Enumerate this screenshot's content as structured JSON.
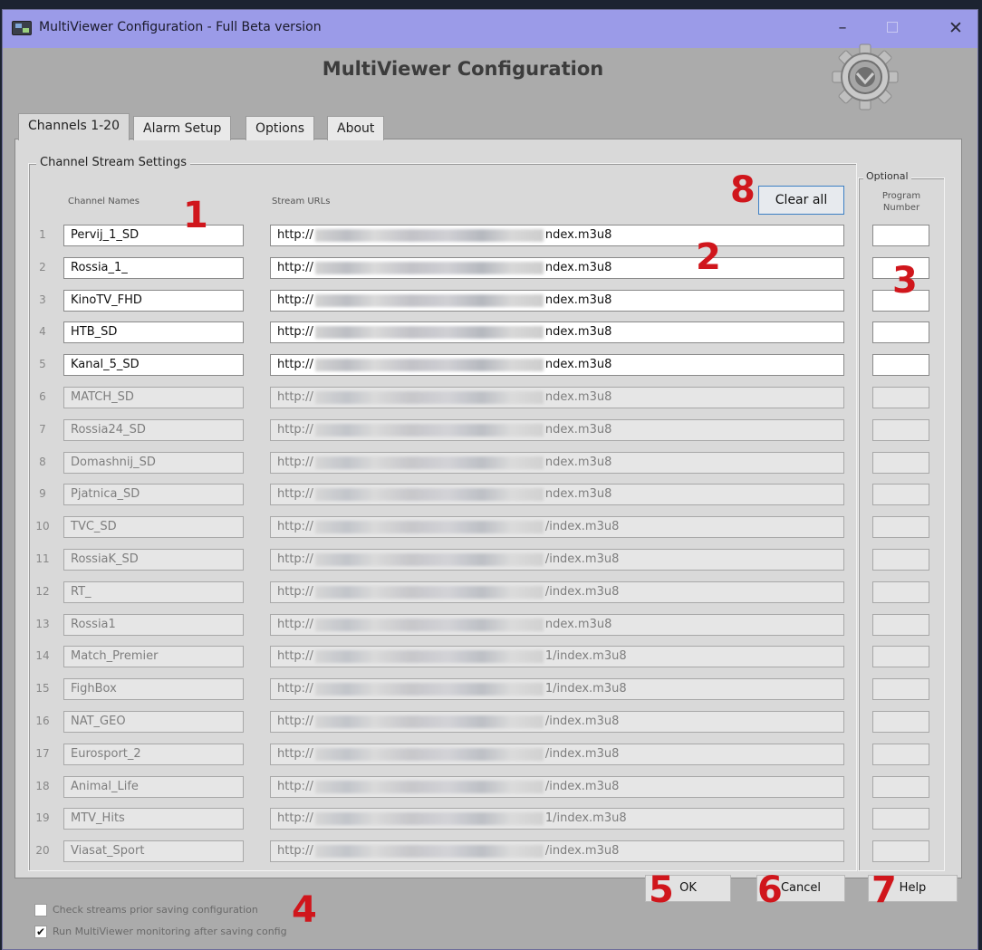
{
  "window": {
    "title": "MultiViewer Configuration - Full Beta version",
    "minimize": "–",
    "close": "✕"
  },
  "header": {
    "title": "MultiViewer Configuration",
    "logo_icon": "gear-icon"
  },
  "tabs": [
    {
      "label": "Channels 1-20",
      "active": true
    },
    {
      "label": "Alarm Setup",
      "active": false
    },
    {
      "label": "Options",
      "active": false
    },
    {
      "label": "About",
      "active": false
    }
  ],
  "panel": {
    "group_label": "Channel Stream Settings",
    "col_names": "Channel Names",
    "col_urls": "Stream URLs",
    "optional_label": "Optional",
    "program_header_1": "Program",
    "program_header_2": "Number",
    "clear_all": "Clear all"
  },
  "channels": [
    {
      "num": "1",
      "name": "Pervij_1_SD",
      "url_prefix": "http://",
      "url_suffix": "ndex.m3u8",
      "enabled": true
    },
    {
      "num": "2",
      "name": "Rossia_1_",
      "url_prefix": "http://",
      "url_suffix": "ndex.m3u8",
      "enabled": true
    },
    {
      "num": "3",
      "name": "KinoTV_FHD",
      "url_prefix": "http://",
      "url_suffix": "ndex.m3u8",
      "enabled": true
    },
    {
      "num": "4",
      "name": "HTB_SD",
      "url_prefix": "http://",
      "url_suffix": "ndex.m3u8",
      "enabled": true
    },
    {
      "num": "5",
      "name": "Kanal_5_SD",
      "url_prefix": "http://",
      "url_suffix": "ndex.m3u8",
      "enabled": true
    },
    {
      "num": "6",
      "name": "MATCH_SD",
      "url_prefix": "http://",
      "url_suffix": "ndex.m3u8",
      "enabled": false
    },
    {
      "num": "7",
      "name": "Rossia24_SD",
      "url_prefix": "http://",
      "url_suffix": "ndex.m3u8",
      "enabled": false
    },
    {
      "num": "8",
      "name": "Domashnij_SD",
      "url_prefix": "http://",
      "url_suffix": "ndex.m3u8",
      "enabled": false
    },
    {
      "num": "9",
      "name": "Pjatnica_SD",
      "url_prefix": "http://",
      "url_suffix": "ndex.m3u8",
      "enabled": false
    },
    {
      "num": "10",
      "name": "TVC_SD",
      "url_prefix": "http://",
      "url_suffix": "/index.m3u8",
      "enabled": false
    },
    {
      "num": "11",
      "name": "RossiaK_SD",
      "url_prefix": "http://",
      "url_suffix": "/index.m3u8",
      "enabled": false
    },
    {
      "num": "12",
      "name": "RT_",
      "url_prefix": "http://",
      "url_suffix": "/index.m3u8",
      "enabled": false
    },
    {
      "num": "13",
      "name": "Rossia1",
      "url_prefix": "http://",
      "url_suffix": "ndex.m3u8",
      "enabled": false
    },
    {
      "num": "14",
      "name": "Match_Premier",
      "url_prefix": "http://",
      "url_suffix": "1/index.m3u8",
      "enabled": false
    },
    {
      "num": "15",
      "name": "FighBox",
      "url_prefix": "http://",
      "url_suffix": "1/index.m3u8",
      "enabled": false
    },
    {
      "num": "16",
      "name": "NAT_GEO",
      "url_prefix": "http://",
      "url_suffix": "/index.m3u8",
      "enabled": false
    },
    {
      "num": "17",
      "name": "Eurosport_2",
      "url_prefix": "http://",
      "url_suffix": "/index.m3u8",
      "enabled": false
    },
    {
      "num": "18",
      "name": "Animal_Life",
      "url_prefix": "http://",
      "url_suffix": "/index.m3u8",
      "enabled": false
    },
    {
      "num": "19",
      "name": "MTV_Hits",
      "url_prefix": "http://",
      "url_suffix": "1/index.m3u8",
      "enabled": false
    },
    {
      "num": "20",
      "name": "Viasat_Sport",
      "url_prefix": "http://",
      "url_suffix": "/index.m3u8",
      "enabled": false
    }
  ],
  "options": {
    "check_streams": {
      "label": "Check streams prior saving configuration",
      "checked": false
    },
    "run_monitoring": {
      "label": "Run MultiViewer monitoring after saving config",
      "checked": true
    }
  },
  "buttons": {
    "ok": "OK",
    "cancel": "Cancel",
    "help": "Help"
  },
  "annotations": [
    "1",
    "2",
    "3",
    "4",
    "5",
    "6",
    "7",
    "8"
  ],
  "colors": {
    "titlebar": "#9b9be8",
    "marker": "#d0161c",
    "panel": "#d9d9d9",
    "window": "#ababab"
  }
}
